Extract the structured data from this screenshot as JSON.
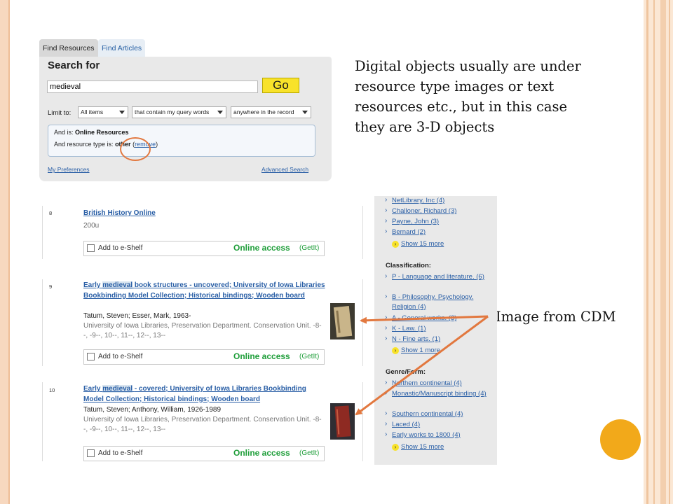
{
  "search": {
    "tabs": [
      "Find Resources",
      "Find Articles"
    ],
    "title": "Search for",
    "query": "medieval",
    "go_label": "Go",
    "limit_label": "Limit to:",
    "limit_options": [
      "All items",
      "that contain my query words",
      "anywhere in the record"
    ],
    "filter_row1_prefix": "And   is:",
    "filter_row1_value": "Online Resources",
    "filter_row2_prefix": "And resource type is:",
    "filter_row2_value": "other",
    "filter_remove": "remove",
    "my_preferences": "My Preferences",
    "advanced_search": "Advanced Search"
  },
  "annotations": {
    "objects_note": "Digital objects usually are under resource type images or text resources etc., but in this case they are 3-D objects",
    "image_note": "Image from CDM"
  },
  "results": [
    {
      "num": "8",
      "title_pre": "British History Online",
      "title_hl": "",
      "title_post": "",
      "author": "",
      "publisher": "",
      "misc": "200u",
      "shelf_label": "Add to e-Shelf",
      "online_label": "Online access",
      "getit_label": "(GetIt)"
    },
    {
      "num": "9",
      "title_pre": "Early",
      "title_hl": "medieval",
      "title_post": "book structures - uncovered; University of Iowa Libraries Bookbinding Model Collection; Historical bindings; Wooden board",
      "author": "Tatum, Steven; Esser, Mark, 1963-",
      "publisher": "University of Iowa Libraries, Preservation Department. Conservation Unit. -8--, -9--, 10--, 11--, 12--, 13--",
      "misc": "",
      "shelf_label": "Add to e-Shelf",
      "online_label": "Online access",
      "getit_label": "(GetIt)"
    },
    {
      "num": "10",
      "title_pre": "Early",
      "title_hl": "medieval",
      "title_post": "- covered; University of Iowa Libraries Bookbinding Model Collection; Historical bindings; Wooden board",
      "author": "Tatum, Steven; Anthony, William, 1926-1989",
      "publisher": "University of Iowa Libraries, Preservation Department. Conservation Unit. -8--, -9--, 10--, 11--, 12--, 13--",
      "misc": "",
      "shelf_label": "Add to e-Shelf",
      "online_label": "Online access",
      "getit_label": "(GetIt)"
    }
  ],
  "facets": {
    "authors": [
      "NetLibrary, Inc (4)",
      "Challoner, Richard (3)",
      "Payne, John (3)",
      "Bernard (2)"
    ],
    "authors_more": "Show 15 more",
    "classification_heading": "Classification:",
    "classification": [
      "P - Language and literature. (6)",
      "B - Philosophy. Psychology. Religion (4)",
      "A - General works. (3)",
      "K - Law. (1)",
      "N - Fine arts. (1)"
    ],
    "classification_more": "Show 1 more",
    "genre_heading": "Genre/Form:",
    "genre": [
      "Northern continental (4)",
      "Monastic/Manuscript binding (4)",
      "Southern continental (4)",
      "Laced (4)",
      "Early works to 1800 (4)"
    ],
    "genre_more": "Show 15 more"
  },
  "colors": {
    "link": "#2a5fa6",
    "online": "#1f9e3a",
    "go_button": "#f8e22a",
    "arrow": "#e2783f",
    "accent_circle": "#f2a91a",
    "frame": "#f7d8bf"
  }
}
